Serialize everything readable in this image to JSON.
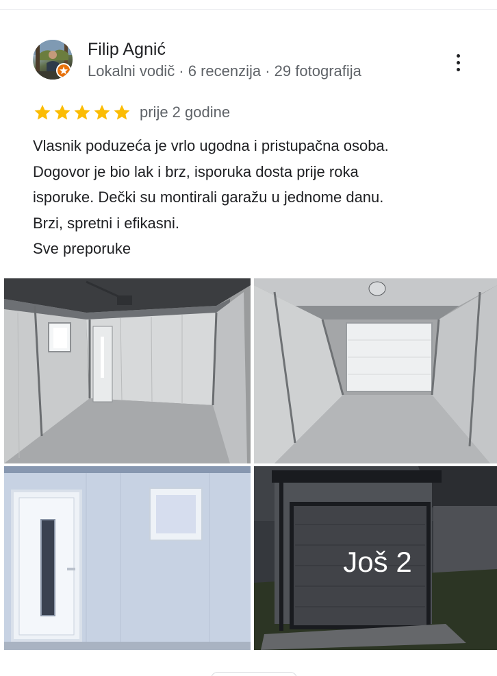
{
  "review": {
    "author_name": "Filip Agnić",
    "author_meta": "Lokalni vodič · 6 recenzija · 29 fotografija",
    "rating": 5,
    "rating_max": 5,
    "date": "prije 2 godine",
    "text_lines": [
      "Vlasnik poduzeća je vrlo ugodna i pristupačna osoba.",
      "Dogovor je bio lak i brz, isporuka dosta prije roka",
      "isporuke. Dečki su montirali garažu u jednome danu.",
      "Brzi, spretni i efikasni."
    ],
    "more_link": "Sve preporuke",
    "more_photos_label": "Još 2"
  },
  "colors": {
    "star": "#fbbc04",
    "guide_badge": "#e8710a",
    "secondary_text": "#5f6368"
  },
  "icons": {
    "avatar": "user-avatar",
    "badge": "local-guide-badge-icon",
    "menu": "more-vert-icon",
    "star": "star-icon"
  }
}
